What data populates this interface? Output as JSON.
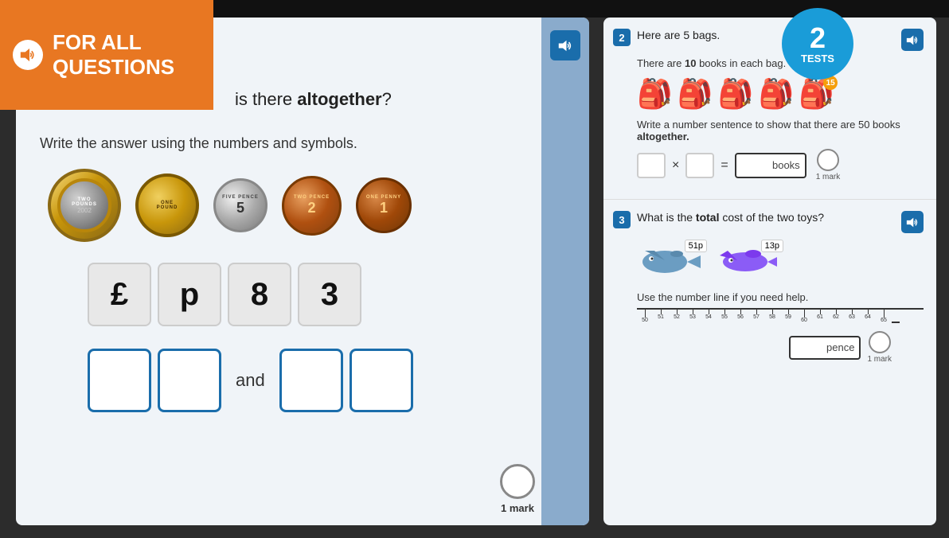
{
  "top_bar": {},
  "header": {
    "for_all": "FOR ALL",
    "questions": "QUESTIONS",
    "question_intro_pre": "is there ",
    "question_intro_bold": "altogether",
    "question_intro_post": "?"
  },
  "tests_badge": {
    "number": "2",
    "label": "TESTS"
  },
  "left_panel": {
    "write_instruction": "Write the answer using the numbers and symbols.",
    "coins": [
      {
        "id": "two-pound",
        "text_top": "TWO",
        "text_mid": "POUNDS",
        "text_bot": "2002",
        "inner_text": ""
      },
      {
        "id": "one-pound",
        "text_top": "ONE",
        "text_mid": "POUND",
        "text_bot": ""
      },
      {
        "id": "five-pence",
        "text_top": "FIVE",
        "text_mid": "5",
        "text_bot": "PENCE"
      },
      {
        "id": "two-pence",
        "text_top": "TWO",
        "text_mid": "2",
        "text_bot": "PENCE"
      },
      {
        "id": "one-penny",
        "text_top": "ONE",
        "text_mid": "1",
        "text_bot": "PENNY"
      }
    ],
    "answer_symbols": [
      "£",
      "p",
      "8",
      "3"
    ],
    "and_label": "and",
    "mark": "1 mark"
  },
  "right_panel": {
    "question2": {
      "number": "2",
      "title": "Here are 5 bags.",
      "subtitle": "There are 10 books in each bag.",
      "bags": [
        "🎒",
        "🎒",
        "🎒",
        "🎒",
        "🎒"
      ],
      "bag_colors": [
        "#8B5CF6",
        "#EF4444",
        "#6B7280",
        "#EF4444",
        "#F59E0B"
      ],
      "sentence_instruction": "Write a number sentence to show that there are 50 books",
      "sentence_bold": "altogether.",
      "multiply_symbol": "×",
      "equals_symbol": "=",
      "books_label": "books",
      "mark": "1 mark"
    },
    "question3": {
      "number": "3",
      "title_pre": "What is the ",
      "title_bold": "total",
      "title_post": " cost of the two toys?",
      "toy1_label": "51p",
      "toy2_label": "13p",
      "use_instruction": "Use the number line if you need help.",
      "number_line_start": 50,
      "number_line_end": 65,
      "number_line_numbers": [
        "50",
        "51",
        "52",
        "53",
        "54",
        "55",
        "56",
        "57",
        "58",
        "59",
        "60",
        "61",
        "62",
        "63",
        "64",
        "65"
      ],
      "pence_label": "pence",
      "mark": "1 mark"
    }
  },
  "icons": {
    "speaker": "🔊"
  }
}
